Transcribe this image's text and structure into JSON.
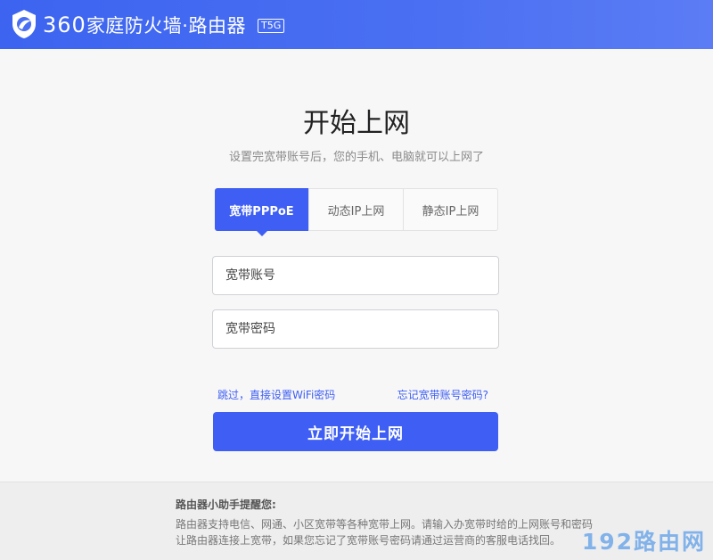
{
  "header": {
    "brand_number": "360",
    "brand_title": "家庭防火墙·路由器",
    "model": "T5G",
    "logo_icon": "shield-logo-icon"
  },
  "main": {
    "title": "开始上网",
    "subtitle": "设置完宽带账号后，您的手机、电脑就可以上网了",
    "tabs": [
      {
        "label": "宽带PPPoE",
        "active": true
      },
      {
        "label": "动态IP上网",
        "active": false
      },
      {
        "label": "静态IP上网",
        "active": false
      }
    ],
    "account_field": {
      "placeholder": "宽带账号",
      "value": ""
    },
    "password_field": {
      "placeholder": "宽带密码",
      "value": ""
    },
    "skip_link": "跳过，直接设置WiFi密码",
    "forgot_link": "忘记宽带账号密码?",
    "submit_label": "立即开始上网"
  },
  "footer": {
    "tips_title": "路由器小助手提醒您:",
    "tips_line_1": "路由器支持电信、网通、小区宽带等各种宽带上网。请输入办宽带时给的上网账号和密码",
    "tips_line_2": "让路由器连接上宽带，如果您忘记了宽带账号密码请通过运营商的客服电话找回。",
    "watermark": "192路由网"
  },
  "colors": {
    "accent": "#3e5ef4",
    "header_bg": "#4a6ff2"
  }
}
